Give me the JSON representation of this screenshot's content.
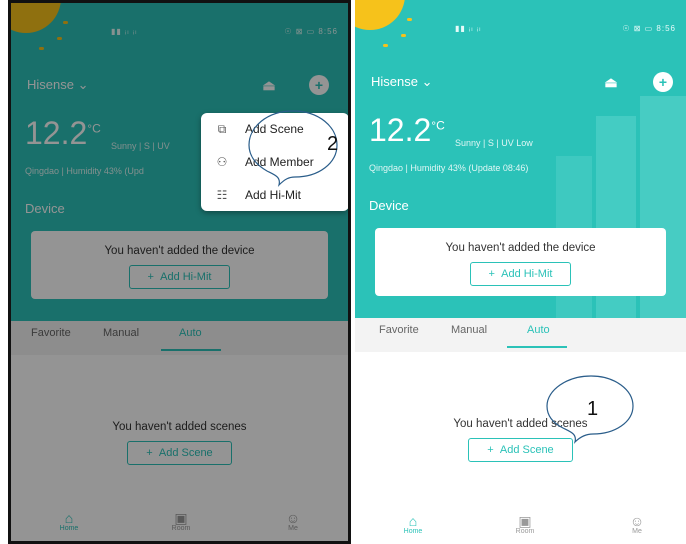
{
  "status_bar": {
    "left_icons": "▮▮ ᵢₗ ᵢₗ",
    "right_time": "☉ ⊠ ▭ 8:56"
  },
  "header": {
    "brand": "Hisense ⌄",
    "alarm_icon": "alarm-icon",
    "add_icon": "plus-icon"
  },
  "weather": {
    "temperature": "12.2",
    "unit": "°C",
    "summary": "Sunny  |  S  |  UV Low",
    "summary_left": "Sunny  |  S  |  UV",
    "location": "Qingdao",
    "humidity_line": "Qingdao  |  Humidity 43%  (Update 08:46)",
    "humidity_line_left": "Qingdao  |  Humidity 43%  (Upd"
  },
  "device": {
    "title": "Device",
    "empty_message": "You haven't added the device",
    "add_button": "Add Hi-Mit"
  },
  "tabs": [
    "Favorite",
    "Manual",
    "Auto"
  ],
  "scenes": {
    "empty_message": "You haven't added scenes",
    "add_button": "Add Scene"
  },
  "bottom_nav": [
    {
      "label": "Home",
      "icon": "home-icon"
    },
    {
      "label": "Room",
      "icon": "room-icon"
    },
    {
      "label": "Me",
      "icon": "user-icon"
    }
  ],
  "popup_menu": [
    {
      "label": "Add Scene",
      "icon": "scene-icon"
    },
    {
      "label": "Add Member",
      "icon": "add-member-icon"
    },
    {
      "label": "Add Hi-Mit",
      "icon": "device-icon"
    }
  ],
  "callouts": {
    "one": "1",
    "two": "2"
  },
  "colors": {
    "accent": "#2bc2b8",
    "sun": "#f6c21b"
  }
}
